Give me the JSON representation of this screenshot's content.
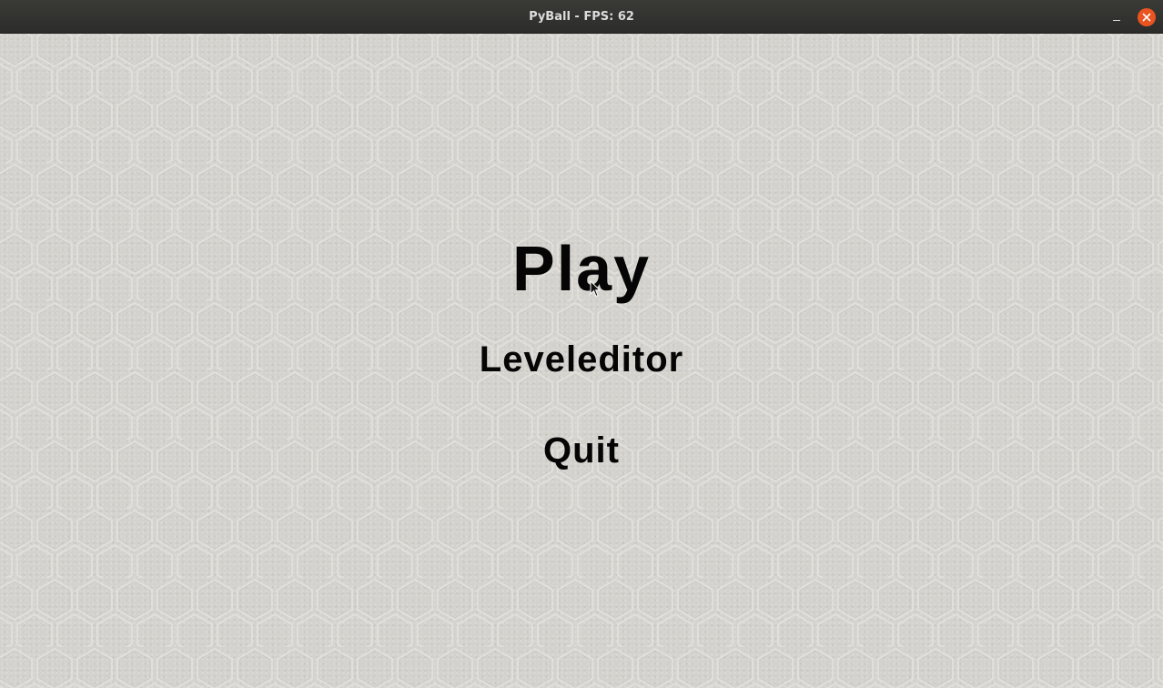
{
  "window": {
    "title": "PyBall - FPS: 62"
  },
  "menu": {
    "items": [
      {
        "label": "Play"
      },
      {
        "label": "Leveleditor"
      },
      {
        "label": "Quit"
      }
    ]
  },
  "icons": {
    "minimize": "minimize-icon",
    "close": "close-icon",
    "cursor": "mouse-pointer-icon"
  },
  "colors": {
    "titlebar": "#2c2c2a",
    "close_button": "#e95420",
    "background": "#d3d2cd",
    "menu_text": "#050505"
  }
}
